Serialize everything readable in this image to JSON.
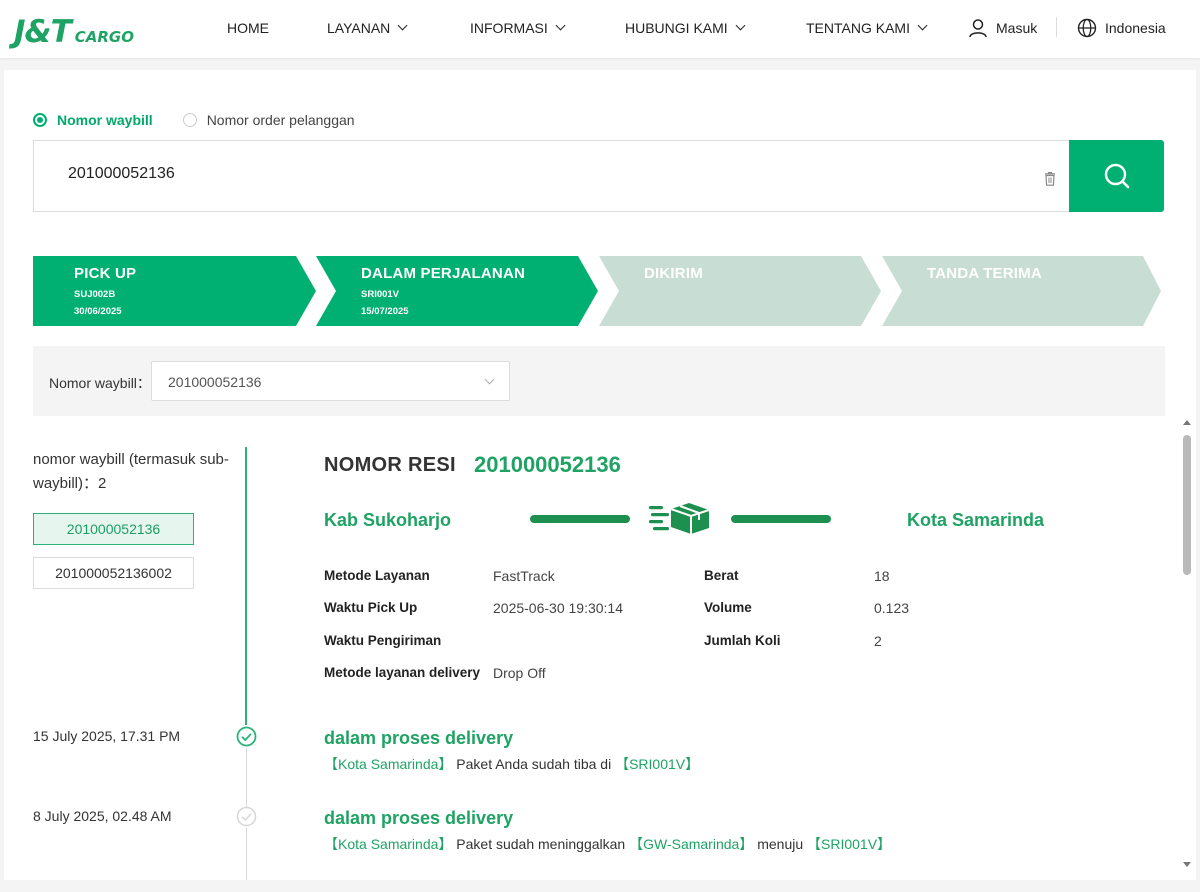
{
  "header": {
    "logo_mark": "J&T",
    "logo_sub": "CARGO",
    "nav": [
      {
        "label": "HOME",
        "dropdown": false
      },
      {
        "label": "LAYANAN",
        "dropdown": true
      },
      {
        "label": "INFORMASI",
        "dropdown": true
      },
      {
        "label": "HUBUNGI KAMI",
        "dropdown": true
      },
      {
        "label": "TENTANG KAMI",
        "dropdown": true
      }
    ],
    "login_label": "Masuk",
    "language_label": "Indonesia"
  },
  "search": {
    "options": [
      {
        "label": "Nomor waybill",
        "selected": true
      },
      {
        "label": "Nomor order pelanggan",
        "selected": false
      }
    ],
    "value": "201000052136",
    "icons": {
      "clear": "trash-icon",
      "submit": "search-icon"
    }
  },
  "steps": [
    {
      "title": "PICK UP",
      "code": "SUJ002B",
      "date": "30/06/2025",
      "active": true
    },
    {
      "title": "DALAM PERJALANAN",
      "code": "SRI001V",
      "date": "15/07/2025",
      "active": true
    },
    {
      "title": "DIKIRIM",
      "code": "",
      "date": "",
      "active": false
    },
    {
      "title": "TANDA TERIMA",
      "code": "",
      "date": "",
      "active": false
    }
  ],
  "colors": {
    "accent": "#00b073",
    "step_active": "#00b073",
    "step_inactive": "#c8ddd4",
    "text_green": "#1fa364"
  },
  "filter": {
    "label": "Nomor waybill：",
    "value": "201000052136"
  },
  "sidebar": {
    "count_text": "nomor waybill (termasuk sub-waybill)：2",
    "waybills": [
      {
        "number": "201000052136",
        "active": true
      },
      {
        "number": "201000052136002",
        "active": false
      }
    ]
  },
  "detail": {
    "resi_label": "NOMOR RESI",
    "resi_value": "201000052136",
    "origin": "Kab Sukoharjo",
    "destination": "Kota Samarinda",
    "fields_left": [
      {
        "label": "Metode Layanan",
        "value": "FastTrack"
      },
      {
        "label": "Waktu Pick Up",
        "value": "2025-06-30 19:30:14"
      },
      {
        "label": "Waktu Pengiriman",
        "value": ""
      },
      {
        "label": "Metode layanan delivery",
        "value": "Drop Off"
      }
    ],
    "fields_right": [
      {
        "label": "Berat",
        "value": "18"
      },
      {
        "label": "Volume",
        "value": "0.123"
      },
      {
        "label": "Jumlah Koli",
        "value": "2"
      }
    ]
  },
  "timeline": [
    {
      "date": "15 July 2025, 17.31 PM",
      "title": "dalam proses delivery",
      "desc": [
        {
          "text": "【Kota Samarinda】",
          "hl": true
        },
        {
          "text": "Paket Anda sudah tiba di",
          "hl": false
        },
        {
          "text": "【SRI001V】",
          "hl": true
        }
      ],
      "current": true
    },
    {
      "date": "8 July 2025, 02.48 AM",
      "title": "dalam proses delivery",
      "desc": [
        {
          "text": "【Kota Samarinda】",
          "hl": true
        },
        {
          "text": "Paket sudah meninggalkan",
          "hl": false
        },
        {
          "text": "【GW-Samarinda】",
          "hl": true
        },
        {
          "text": "menuju",
          "hl": false
        },
        {
          "text": "【SRI001V】",
          "hl": true
        }
      ],
      "current": false
    }
  ]
}
